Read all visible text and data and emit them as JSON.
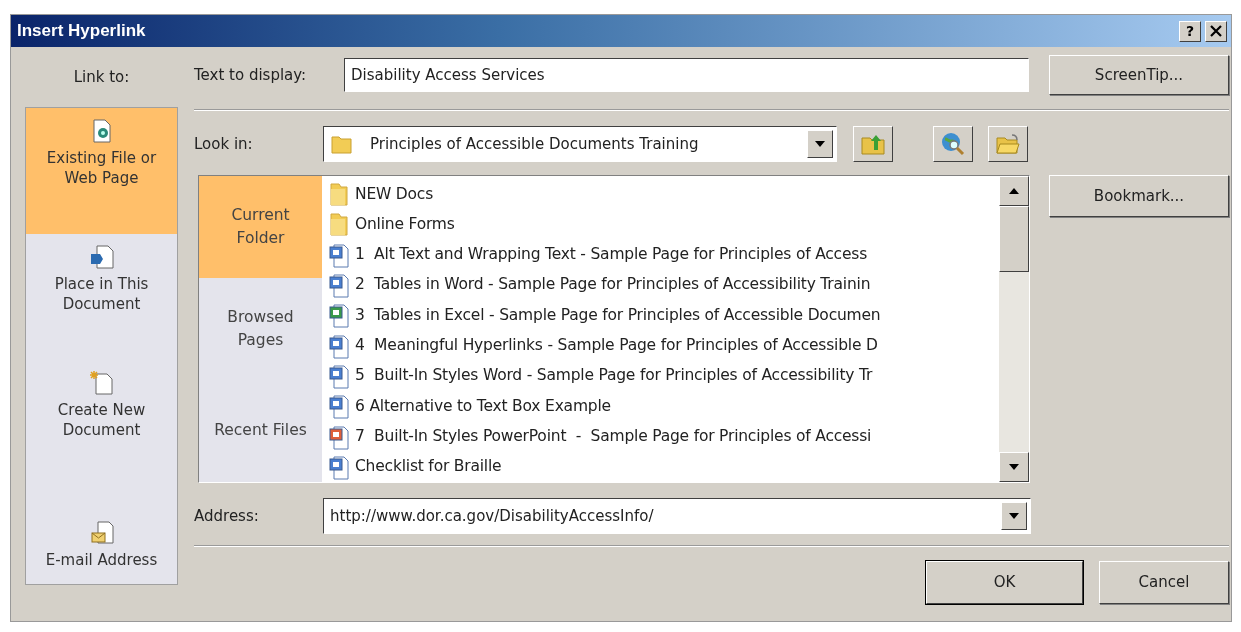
{
  "window": {
    "title": "Insert Hyperlink",
    "help_button": "?"
  },
  "link_to": {
    "label": "Link to:",
    "items": [
      {
        "label": "Existing File or Web Page",
        "kind": "file",
        "selected": true
      },
      {
        "label": "Place in This Document",
        "kind": "place",
        "selected": false
      },
      {
        "label": "Create New Document",
        "kind": "new",
        "selected": false
      },
      {
        "label": "E-mail Address",
        "kind": "email",
        "selected": false
      }
    ]
  },
  "text_to_display": {
    "label": "Text to display:",
    "value": "Disability Access Services"
  },
  "screentip_button": "ScreenTip...",
  "look_in": {
    "label": "Look in:",
    "value": "Principles of Accessible Documents Training"
  },
  "browse_tabs": [
    {
      "label": "Current Folder",
      "selected": true
    },
    {
      "label": "Browsed Pages",
      "selected": false
    },
    {
      "label": "Recent Files",
      "selected": false
    }
  ],
  "files": [
    {
      "name": "NEW Docs",
      "kind": "folder"
    },
    {
      "name": "Online Forms",
      "kind": "folder"
    },
    {
      "name": "1  Alt Text and Wrapping Text - Sample Page for Principles of Access",
      "kind": "word"
    },
    {
      "name": "2  Tables in Word - Sample Page for Principles of Accessibility Trainin",
      "kind": "word"
    },
    {
      "name": "3  Tables in Excel - Sample Page for Principles of Accessible Documen",
      "kind": "excel"
    },
    {
      "name": "4  Meaningful Hyperlinks - Sample Page for Principles of Accessible D",
      "kind": "word"
    },
    {
      "name": "5  Built-In Styles Word - Sample Page for Principles of Accessibility Tr",
      "kind": "word"
    },
    {
      "name": "6 Alternative to Text Box Example",
      "kind": "word"
    },
    {
      "name": "7  Built-In Styles PowerPoint  -  Sample Page for Principles of Accessi",
      "kind": "powerpoint"
    },
    {
      "name": "Checklist for Braille",
      "kind": "word"
    }
  ],
  "bookmark_button": "Bookmark...",
  "address": {
    "label": "Address:",
    "value": "http://www.dor.ca.gov/DisabilityAccessInfo/"
  },
  "buttons": [
    "OK",
    "Cancel"
  ]
}
